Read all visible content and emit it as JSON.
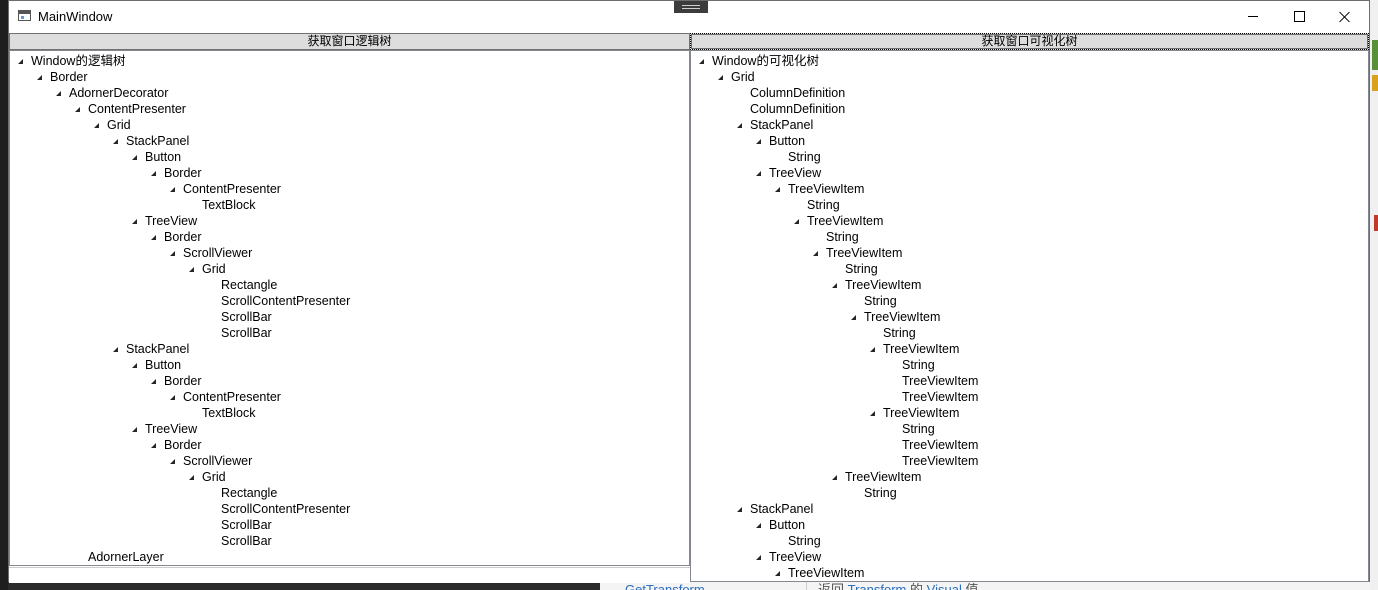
{
  "window": {
    "title": "MainWindow"
  },
  "left_pane": {
    "button_label": "获取窗口逻辑树",
    "nodes": [
      {
        "text": "Window的逻辑树",
        "depth": 0,
        "expanded": true
      },
      {
        "text": "Border",
        "depth": 1,
        "expanded": true
      },
      {
        "text": "AdornerDecorator",
        "depth": 2,
        "expanded": true
      },
      {
        "text": "ContentPresenter",
        "depth": 3,
        "expanded": true
      },
      {
        "text": "Grid",
        "depth": 4,
        "expanded": true
      },
      {
        "text": "StackPanel",
        "depth": 5,
        "expanded": true
      },
      {
        "text": "Button",
        "depth": 6,
        "expanded": true
      },
      {
        "text": "Border",
        "depth": 7,
        "expanded": true
      },
      {
        "text": "ContentPresenter",
        "depth": 8,
        "expanded": true
      },
      {
        "text": "TextBlock",
        "depth": 9,
        "expanded": false
      },
      {
        "text": "TreeView",
        "depth": 6,
        "expanded": true
      },
      {
        "text": "Border",
        "depth": 7,
        "expanded": true
      },
      {
        "text": "ScrollViewer",
        "depth": 8,
        "expanded": true
      },
      {
        "text": "Grid",
        "depth": 9,
        "expanded": true
      },
      {
        "text": "Rectangle",
        "depth": 10,
        "expanded": false
      },
      {
        "text": "ScrollContentPresenter",
        "depth": 10,
        "expanded": false
      },
      {
        "text": "ScrollBar",
        "depth": 10,
        "expanded": false
      },
      {
        "text": "ScrollBar",
        "depth": 10,
        "expanded": false
      },
      {
        "text": "StackPanel",
        "depth": 5,
        "expanded": true
      },
      {
        "text": "Button",
        "depth": 6,
        "expanded": true
      },
      {
        "text": "Border",
        "depth": 7,
        "expanded": true
      },
      {
        "text": "ContentPresenter",
        "depth": 8,
        "expanded": true
      },
      {
        "text": "TextBlock",
        "depth": 9,
        "expanded": false
      },
      {
        "text": "TreeView",
        "depth": 6,
        "expanded": true
      },
      {
        "text": "Border",
        "depth": 7,
        "expanded": true
      },
      {
        "text": "ScrollViewer",
        "depth": 8,
        "expanded": true
      },
      {
        "text": "Grid",
        "depth": 9,
        "expanded": true
      },
      {
        "text": "Rectangle",
        "depth": 10,
        "expanded": false
      },
      {
        "text": "ScrollContentPresenter",
        "depth": 10,
        "expanded": false
      },
      {
        "text": "ScrollBar",
        "depth": 10,
        "expanded": false
      },
      {
        "text": "ScrollBar",
        "depth": 10,
        "expanded": false
      },
      {
        "text": "AdornerLayer",
        "depth": 3,
        "expanded": false
      }
    ]
  },
  "right_pane": {
    "button_label": "获取窗口可视化树",
    "nodes": [
      {
        "text": "Window的可视化树",
        "depth": 0,
        "expanded": true
      },
      {
        "text": "Grid",
        "depth": 1,
        "expanded": true
      },
      {
        "text": "ColumnDefinition",
        "depth": 2,
        "expanded": false
      },
      {
        "text": "ColumnDefinition",
        "depth": 2,
        "expanded": false
      },
      {
        "text": "StackPanel",
        "depth": 2,
        "expanded": true
      },
      {
        "text": "Button",
        "depth": 3,
        "expanded": true
      },
      {
        "text": "String",
        "depth": 4,
        "expanded": false
      },
      {
        "text": "TreeView",
        "depth": 3,
        "expanded": true
      },
      {
        "text": "TreeViewItem",
        "depth": 4,
        "expanded": true
      },
      {
        "text": "String",
        "depth": 5,
        "expanded": false
      },
      {
        "text": "TreeViewItem",
        "depth": 5,
        "expanded": true
      },
      {
        "text": "String",
        "depth": 6,
        "expanded": false
      },
      {
        "text": "TreeViewItem",
        "depth": 6,
        "expanded": true
      },
      {
        "text": "String",
        "depth": 7,
        "expanded": false
      },
      {
        "text": "TreeViewItem",
        "depth": 7,
        "expanded": true
      },
      {
        "text": "String",
        "depth": 8,
        "expanded": false
      },
      {
        "text": "TreeViewItem",
        "depth": 8,
        "expanded": true
      },
      {
        "text": "String",
        "depth": 9,
        "expanded": false
      },
      {
        "text": "TreeViewItem",
        "depth": 9,
        "expanded": true
      },
      {
        "text": "String",
        "depth": 10,
        "expanded": false
      },
      {
        "text": "TreeViewItem",
        "depth": 10,
        "expanded": false
      },
      {
        "text": "TreeViewItem",
        "depth": 10,
        "expanded": false
      },
      {
        "text": "TreeViewItem",
        "depth": 9,
        "expanded": true
      },
      {
        "text": "String",
        "depth": 10,
        "expanded": false
      },
      {
        "text": "TreeViewItem",
        "depth": 10,
        "expanded": false
      },
      {
        "text": "TreeViewItem",
        "depth": 10,
        "expanded": false
      },
      {
        "text": "TreeViewItem",
        "depth": 7,
        "expanded": true
      },
      {
        "text": "String",
        "depth": 8,
        "expanded": false
      },
      {
        "text": "StackPanel",
        "depth": 2,
        "expanded": true
      },
      {
        "text": "Button",
        "depth": 3,
        "expanded": true
      },
      {
        "text": "String",
        "depth": 4,
        "expanded": false
      },
      {
        "text": "TreeView",
        "depth": 3,
        "expanded": true
      },
      {
        "text": "TreeViewItem",
        "depth": 4,
        "expanded": true
      }
    ]
  },
  "background": {
    "left_link": "GetTransform",
    "right_text_prefix": "返回",
    "right_link1": "Transform",
    "right_text_mid": "的",
    "right_link2": "Visual",
    "right_text_suffix": "值"
  }
}
